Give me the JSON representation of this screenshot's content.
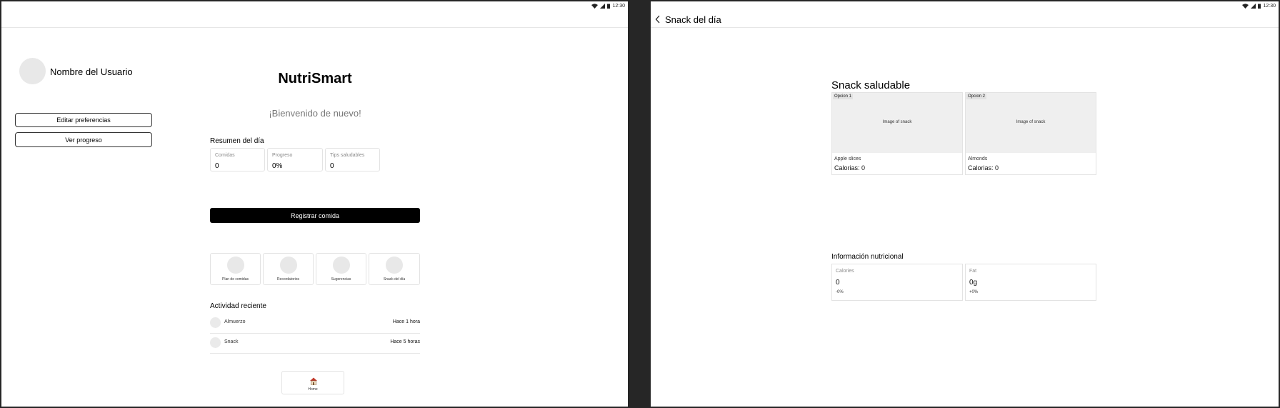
{
  "status": {
    "time": "12:30"
  },
  "home": {
    "user_name": "Nombre del Usuario",
    "buttons": {
      "edit_prefs": "Editar preferencias",
      "view_progress": "Ver progreso"
    },
    "app_title": "NutriSmart",
    "welcome": "¡Bienvenido de nuevo!",
    "summary": {
      "title": "Resumen del día",
      "cards": [
        {
          "label": "Comidas",
          "value": "0"
        },
        {
          "label": "Progreso",
          "value": "0%"
        },
        {
          "label": "Tips saludables",
          "value": "0"
        }
      ]
    },
    "register_button": "Registrar comida",
    "quick_actions": [
      {
        "label": "Plan de comidas"
      },
      {
        "label": "Recordatorios"
      },
      {
        "label": "Sugerencias"
      },
      {
        "label": "Snack del día"
      }
    ],
    "recent": {
      "title": "Actividad reciente",
      "items": [
        {
          "name": "Almuerzo",
          "time": "Hace 1 hora"
        },
        {
          "name": "Snack",
          "time": "Hace 5 horas"
        }
      ]
    },
    "bottom_nav": {
      "home_label": "Home",
      "home_icon": "house-icon"
    }
  },
  "snack": {
    "header_title": "Snack del día",
    "section_title": "Snack saludable",
    "options": [
      {
        "tag": "Opcion 1",
        "image_label": "Image of snack",
        "name": "Apple slices",
        "calories": "Calorias: 0"
      },
      {
        "tag": "Opcion 2",
        "image_label": "Image of snack",
        "name": "Almonds",
        "calories": "Calorias: 0"
      }
    ],
    "nutrition": {
      "title": "Información nutricional",
      "cards": [
        {
          "label": "Calories",
          "value": "0",
          "change": "-0%"
        },
        {
          "label": "Fat",
          "value": "0g",
          "change": "+0%"
        }
      ]
    }
  }
}
